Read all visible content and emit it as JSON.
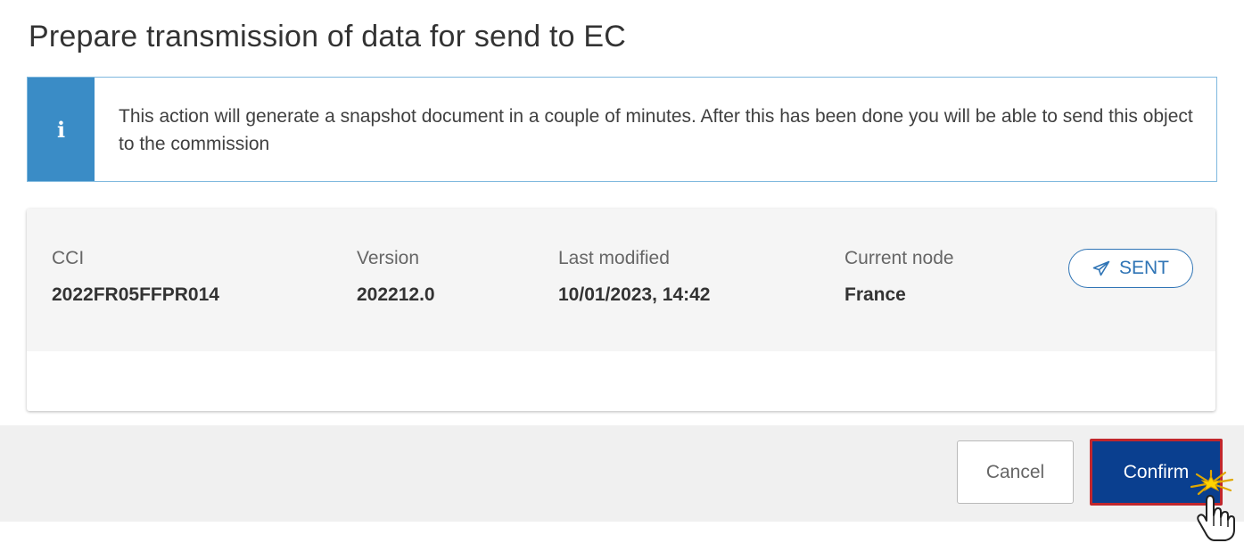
{
  "dialog": {
    "title": "Prepare transmission of data for send to EC"
  },
  "info": {
    "icon": "info-icon",
    "glyph": "i",
    "message": "This action will generate a snapshot document in a couple of minutes. After this has been done you will be able to send this object to the commission"
  },
  "details": {
    "cci": {
      "label": "CCI",
      "value": "2022FR05FFPR014"
    },
    "version": {
      "label": "Version",
      "value": "202212.0"
    },
    "last_modified": {
      "label": "Last modified",
      "value": "10/01/2023, 14:42"
    },
    "current_node": {
      "label": "Current node",
      "value": "France"
    },
    "status": {
      "label": "SENT",
      "icon": "paper-plane-icon",
      "color": "#2f74b5"
    }
  },
  "buttons": {
    "cancel": "Cancel",
    "confirm": "Confirm",
    "confirm_color": "#0a3f8f",
    "highlight_color": "#c1272d"
  },
  "cursor": {
    "icon": "hand-pointer-click-icon"
  }
}
